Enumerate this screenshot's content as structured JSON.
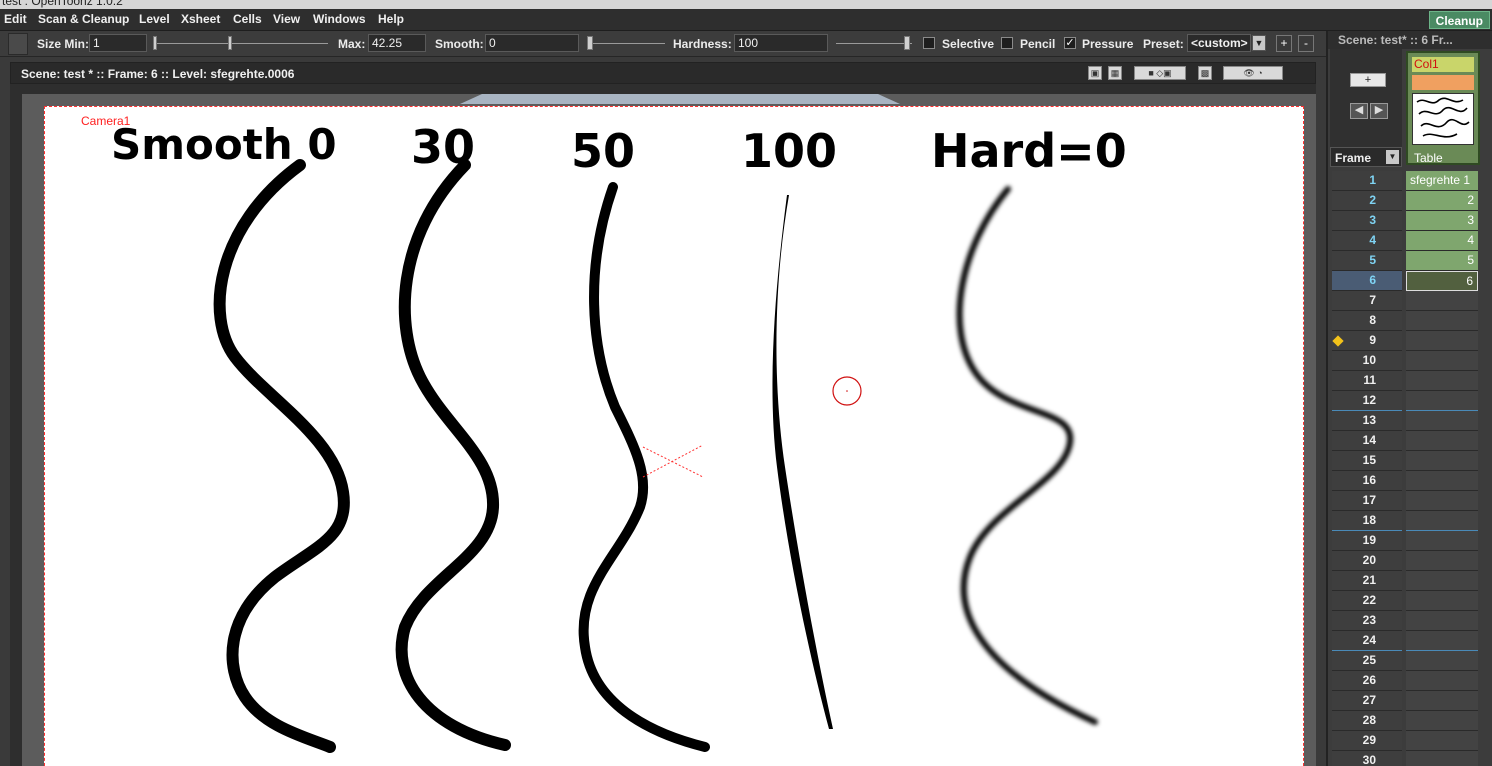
{
  "window": {
    "title": "test : OpenToonz 1.0.2"
  },
  "menu": {
    "items": [
      "Edit",
      "Scan & Cleanup",
      "Level",
      "Xsheet",
      "Cells",
      "View",
      "Windows",
      "Help"
    ],
    "room": "Cleanup"
  },
  "tool_options": {
    "size_min_label": "Size Min:",
    "size_min_value": "1",
    "max_label": "Max:",
    "max_value": "42.25",
    "smooth_label": "Smooth:",
    "smooth_value": "0",
    "hardness_label": "Hardness:",
    "hardness_value": "100",
    "selective_label": "Selective",
    "selective_checked": false,
    "pencil_label": "Pencil",
    "pencil_checked": false,
    "pressure_label": "Pressure",
    "pressure_checked": true,
    "preset_label": "Preset:",
    "preset_value": "<custom>",
    "add_preset": "+",
    "remove_preset": "-"
  },
  "viewer": {
    "info": "Scene: test *  ::  Frame: 6  ::  Level: sfegrehte.0006",
    "camera_label": "Camera1"
  },
  "drawing": {
    "labels": [
      "Smooth  0",
      "30",
      "50",
      "100",
      "Hard=0"
    ]
  },
  "xsheet": {
    "panel_title": "Scene: test*  ::  6 Fr...",
    "frame_header": "Frame",
    "column_name": "Col1",
    "column_type": "Table",
    "level_name": "sfegrehte",
    "current_frame": 6,
    "rows": [
      {
        "n": "1",
        "cell": "sfegrehte 1"
      },
      {
        "n": "2",
        "cell": "2"
      },
      {
        "n": "3",
        "cell": "3"
      },
      {
        "n": "4",
        "cell": "4"
      },
      {
        "n": "5",
        "cell": "5"
      },
      {
        "n": "6",
        "cell": "6"
      },
      {
        "n": "7",
        "cell": ""
      },
      {
        "n": "8",
        "cell": ""
      },
      {
        "n": "9",
        "cell": ""
      },
      {
        "n": "10",
        "cell": ""
      },
      {
        "n": "11",
        "cell": ""
      },
      {
        "n": "12",
        "cell": ""
      },
      {
        "n": "13",
        "cell": ""
      },
      {
        "n": "14",
        "cell": ""
      },
      {
        "n": "15",
        "cell": ""
      },
      {
        "n": "16",
        "cell": ""
      },
      {
        "n": "17",
        "cell": ""
      },
      {
        "n": "18",
        "cell": ""
      },
      {
        "n": "19",
        "cell": ""
      },
      {
        "n": "20",
        "cell": ""
      },
      {
        "n": "21",
        "cell": ""
      },
      {
        "n": "22",
        "cell": ""
      },
      {
        "n": "23",
        "cell": ""
      },
      {
        "n": "24",
        "cell": ""
      },
      {
        "n": "25",
        "cell": ""
      },
      {
        "n": "26",
        "cell": ""
      },
      {
        "n": "27",
        "cell": ""
      },
      {
        "n": "28",
        "cell": ""
      },
      {
        "n": "29",
        "cell": ""
      },
      {
        "n": "30",
        "cell": ""
      }
    ]
  },
  "colors": {
    "accent_green": "#4a8a63",
    "camera_red": "#ff2020",
    "frame_number_cyan": "#7fd4f4",
    "cell_green": "#7fa66e"
  }
}
